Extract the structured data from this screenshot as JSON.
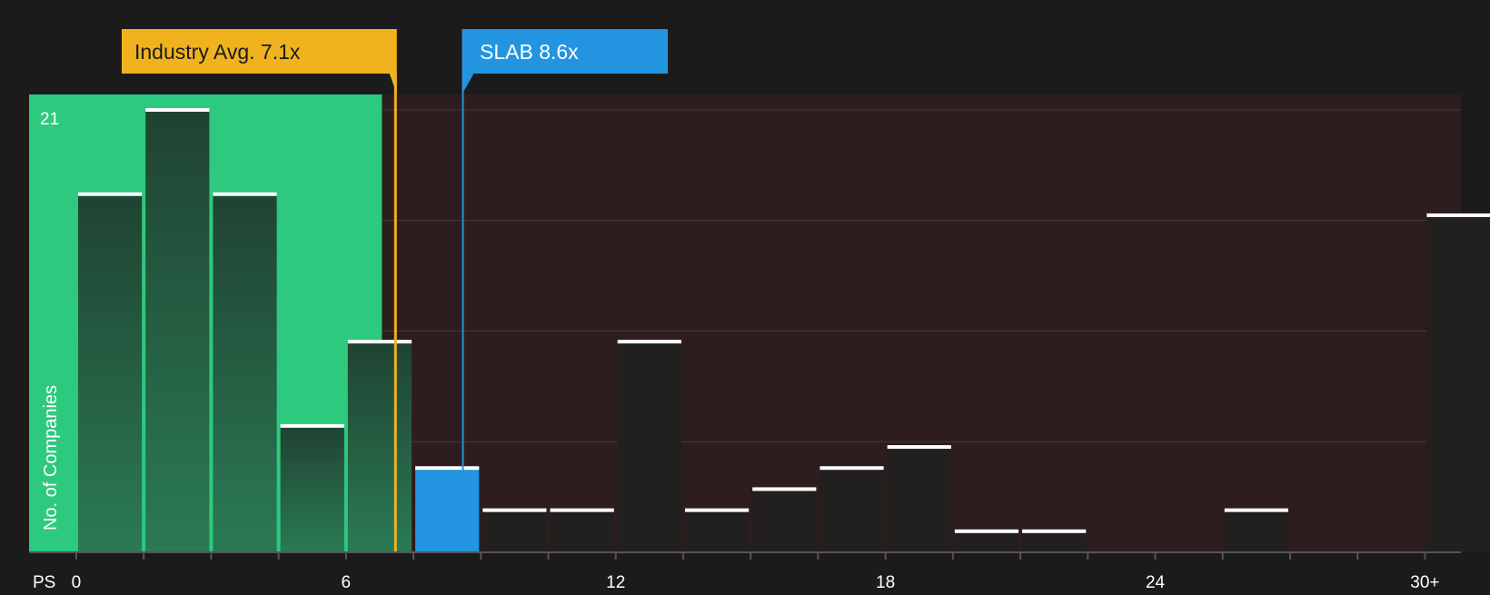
{
  "chart_data": {
    "type": "bar",
    "x_axis_label": "PS",
    "y_axis_label": "No. of Companies",
    "y_max_label": "21",
    "ylim": [
      0,
      21
    ],
    "x_ticks": [
      "0",
      "6",
      "12",
      "18",
      "24",
      "30+"
    ],
    "bins": [
      {
        "from": 0.0,
        "to": 1.5,
        "value": 17,
        "zone": "green"
      },
      {
        "from": 1.5,
        "to": 3.0,
        "value": 21,
        "zone": "green"
      },
      {
        "from": 3.0,
        "to": 4.5,
        "value": 17,
        "zone": "green"
      },
      {
        "from": 4.5,
        "to": 6.0,
        "value": 6,
        "zone": "green"
      },
      {
        "from": 6.0,
        "to": 7.5,
        "value": 10,
        "zone": "green"
      },
      {
        "from": 7.5,
        "to": 9.0,
        "value": 4,
        "zone": "highlight"
      },
      {
        "from": 9.0,
        "to": 10.5,
        "value": 2,
        "zone": "red"
      },
      {
        "from": 10.5,
        "to": 12.0,
        "value": 2,
        "zone": "red"
      },
      {
        "from": 12.0,
        "to": 13.5,
        "value": 10,
        "zone": "red"
      },
      {
        "from": 13.5,
        "to": 15.0,
        "value": 2,
        "zone": "red"
      },
      {
        "from": 15.0,
        "to": 16.5,
        "value": 3,
        "zone": "red"
      },
      {
        "from": 16.5,
        "to": 18.0,
        "value": 4,
        "zone": "red"
      },
      {
        "from": 18.0,
        "to": 19.5,
        "value": 5,
        "zone": "red"
      },
      {
        "from": 19.5,
        "to": 21.0,
        "value": 1,
        "zone": "red"
      },
      {
        "from": 21.0,
        "to": 22.5,
        "value": 1,
        "zone": "red"
      },
      {
        "from": 22.5,
        "to": 24.0,
        "value": 0,
        "zone": "red"
      },
      {
        "from": 24.0,
        "to": 25.5,
        "value": 0,
        "zone": "red"
      },
      {
        "from": 25.5,
        "to": 27.0,
        "value": 2,
        "zone": "red"
      },
      {
        "from": 27.0,
        "to": 28.5,
        "value": 0,
        "zone": "red"
      },
      {
        "from": 28.5,
        "to": 30.0,
        "value": 0,
        "zone": "red"
      },
      {
        "from": 30.0,
        "to": 31.5,
        "value": 16,
        "zone": "red"
      }
    ],
    "industry_avg": {
      "label": "Industry Avg. 7.1x",
      "value": 7.1
    },
    "company": {
      "label": "SLAB 8.6x",
      "value": 8.6
    },
    "fair_zone_end": 6.8,
    "x_domain": [
      -1.05,
      30.8
    ],
    "grid": true,
    "colors": {
      "background": "#1b1b1b",
      "green_zone": "#2dc97e",
      "green_bar": "#204332",
      "red_zone": "#2d1d1e",
      "red_bar": "#221f1f",
      "highlight_bar": "#2394e0",
      "industry_color": "#f0b31f",
      "company_color": "#2394e0",
      "bar_cap": "#ffffff",
      "axis": "#555555",
      "text": "#ffffff"
    }
  }
}
